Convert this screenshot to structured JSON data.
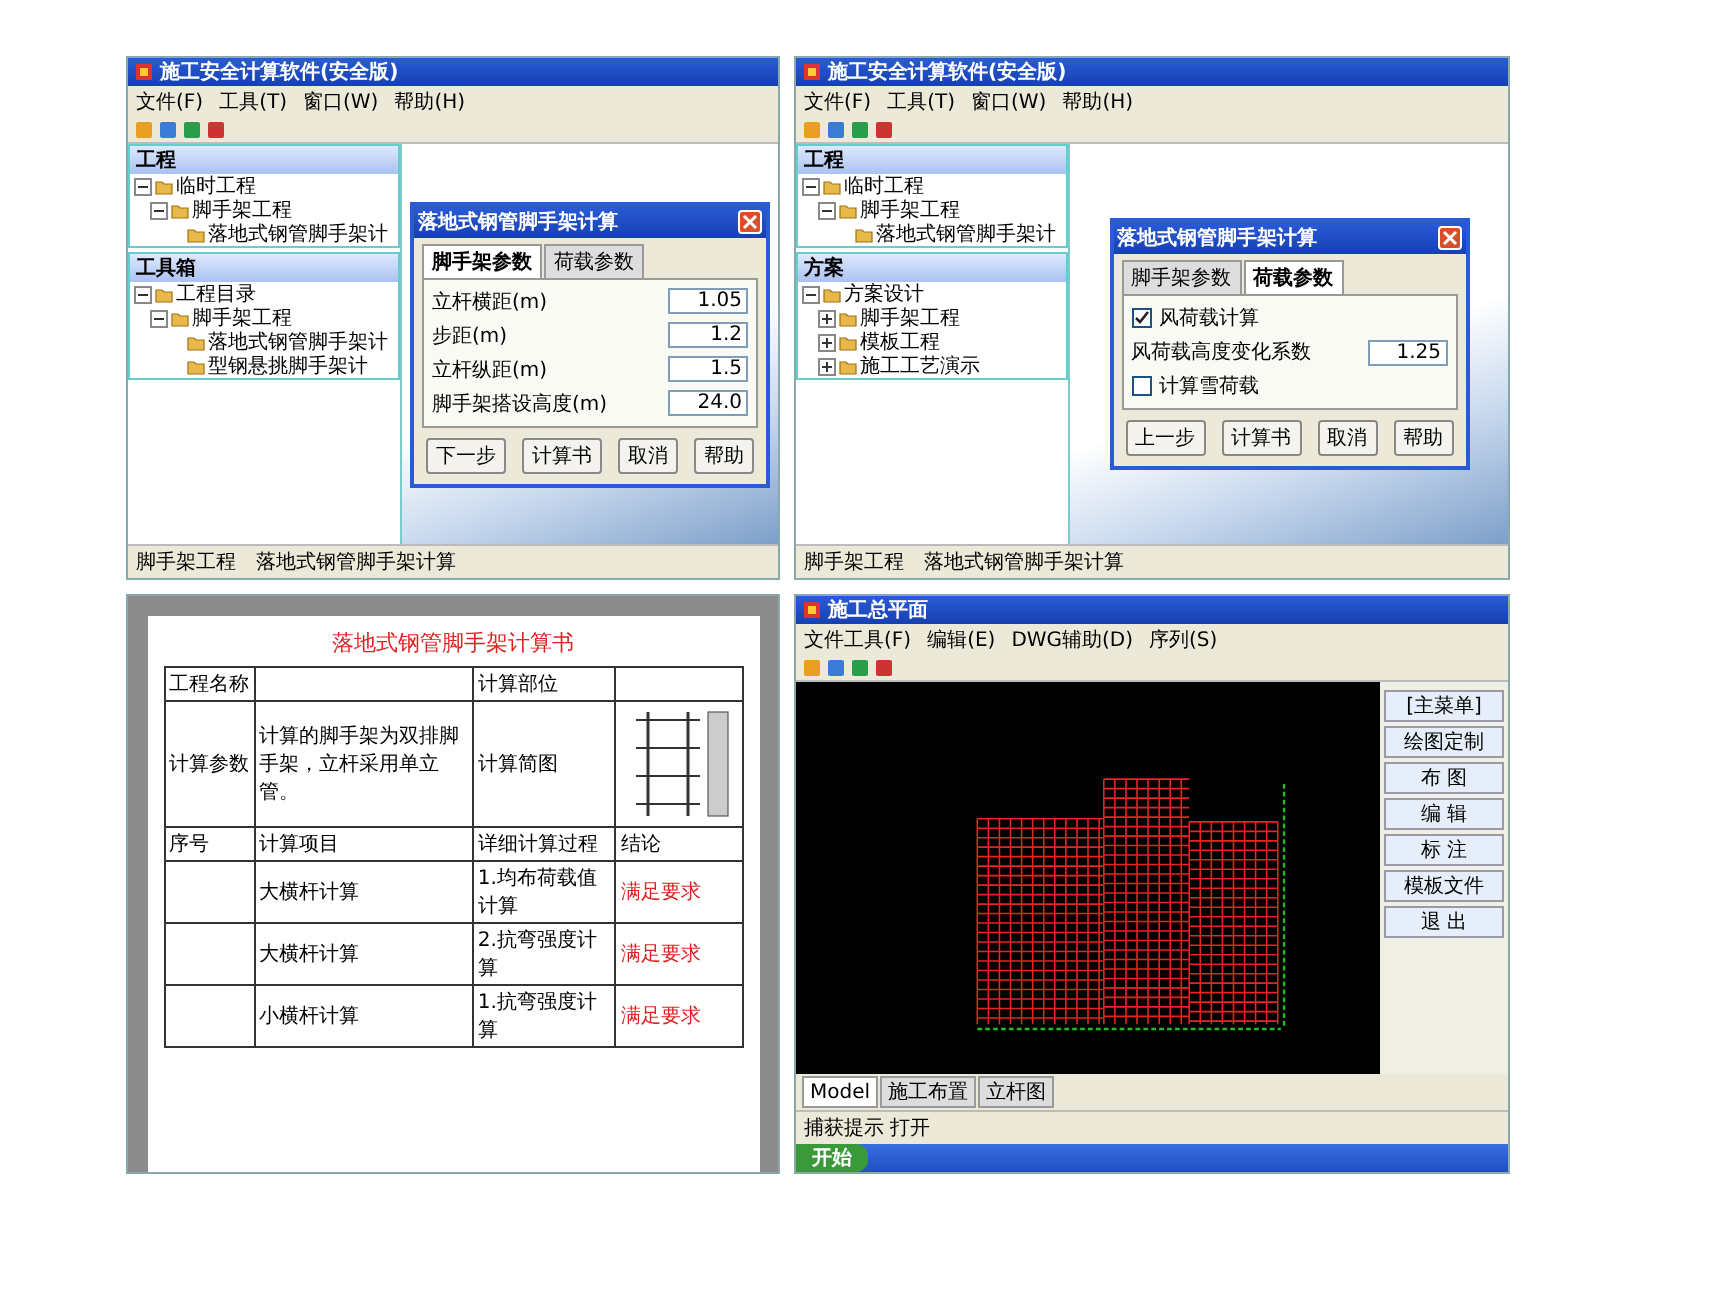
{
  "panels": [
    {
      "kind": "app",
      "title": "施工安全计算软件(安全版)",
      "menu": [
        "文件(F)",
        "工具(T)",
        "窗口(W)",
        "帮助(H)"
      ],
      "sidebar": [
        {
          "title": "工程",
          "tree": [
            {
              "label": "临时工程",
              "expanded": true,
              "children": [
                {
                  "label": "脚手架工程",
                  "expanded": true,
                  "children": [
                    {
                      "label": "落地式钢管脚手架计"
                    }
                  ]
                }
              ]
            }
          ]
        },
        {
          "title": "工具箱",
          "tree": [
            {
              "label": "工程目录",
              "expanded": true,
              "children": [
                {
                  "label": "脚手架工程",
                  "expanded": true,
                  "children": [
                    {
                      "label": "落地式钢管脚手架计"
                    },
                    {
                      "label": "型钢悬挑脚手架计"
                    }
                  ]
                }
              ]
            }
          ]
        }
      ],
      "dialog": {
        "title": "落地式钢管脚手架计算",
        "tabs": [
          {
            "label": "脚手架参数",
            "selected": true
          },
          {
            "label": "荷载参数",
            "selected": false
          }
        ],
        "rows": [
          {
            "kind": "field",
            "label": "立杆横距(m)",
            "value": "1.05"
          },
          {
            "kind": "field",
            "label": "步距(m)",
            "value": "1.2"
          },
          {
            "kind": "field",
            "label": "立杆纵距(m)",
            "value": "1.5"
          },
          {
            "kind": "field",
            "label": "脚手架搭设高度(m)",
            "value": "24.0"
          }
        ],
        "buttons": [
          "下一步",
          "计算书",
          "取消",
          "帮助"
        ]
      },
      "status": [
        "脚手架工程",
        "落地式钢管脚手架计算"
      ]
    },
    {
      "kind": "app",
      "title": "施工安全计算软件(安全版)",
      "menu": [
        "文件(F)",
        "工具(T)",
        "窗口(W)",
        "帮助(H)"
      ],
      "sidebar": [
        {
          "title": "工程",
          "tree": [
            {
              "label": "临时工程",
              "expanded": true,
              "children": [
                {
                  "label": "脚手架工程",
                  "expanded": true,
                  "children": [
                    {
                      "label": "落地式钢管脚手架计"
                    }
                  ]
                }
              ]
            }
          ]
        },
        {
          "title": "方案",
          "tree": [
            {
              "label": "方案设计",
              "expanded": true,
              "children": [
                {
                  "label": "脚手架工程",
                  "expanded": false
                },
                {
                  "label": "模板工程",
                  "expanded": false
                },
                {
                  "label": "施工工艺演示",
                  "expanded": false
                }
              ]
            }
          ]
        }
      ],
      "dialog": {
        "title": "落地式钢管脚手架计算",
        "tabs": [
          {
            "label": "脚手架参数",
            "selected": false
          },
          {
            "label": "荷载参数",
            "selected": true
          }
        ],
        "rows": [
          {
            "kind": "check",
            "label": "风荷载计算",
            "checked": true
          },
          {
            "kind": "field",
            "label": "风荷载高度变化系数",
            "value": "1.25"
          },
          {
            "kind": "check",
            "label": "计算雪荷载",
            "checked": false
          }
        ],
        "buttons": [
          "上一步",
          "计算书",
          "取消",
          "帮助"
        ]
      },
      "status": [
        "脚手架工程",
        "落地式钢管脚手架计算"
      ]
    },
    {
      "kind": "document",
      "title": "落地式钢管脚手架计算书",
      "head": [
        "工程名称",
        "计算部位"
      ],
      "params": {
        "label": "计算参数",
        "text": "计算的脚手架为双排脚手架，立杆采用单立管。",
        "figure_label": "计算简图"
      },
      "columns": [
        "序号",
        "计算项目",
        "详细计算过程",
        "结论"
      ],
      "checks": [
        {
          "item": "大横杆计算",
          "step": "1.均布荷载值计算",
          "verdict": "满足要求",
          "pass": true
        },
        {
          "item": "大横杆计算",
          "step": "2.抗弯强度计算",
          "verdict": "满足要求",
          "pass": true
        },
        {
          "item": "小横杆计算",
          "step": "1.抗弯强度计算",
          "verdict": "满足要求",
          "pass": true
        }
      ]
    },
    {
      "kind": "cad",
      "title": "施工总平面",
      "menu": [
        "文件工具(F)",
        "编辑(E)",
        "DWG辅助(D)",
        "序列(S)"
      ],
      "side": [
        "[主菜单]",
        "绘图定制",
        "布 图",
        "编 辑",
        "标 注",
        "模板文件",
        "退 出"
      ],
      "tabs": [
        {
          "label": "Model",
          "selected": true
        },
        {
          "label": "施工布置",
          "selected": false
        },
        {
          "label": "立杆图",
          "selected": false
        }
      ],
      "status": "捕获提示 打开",
      "taskbar": {
        "start": "开始"
      }
    }
  ]
}
